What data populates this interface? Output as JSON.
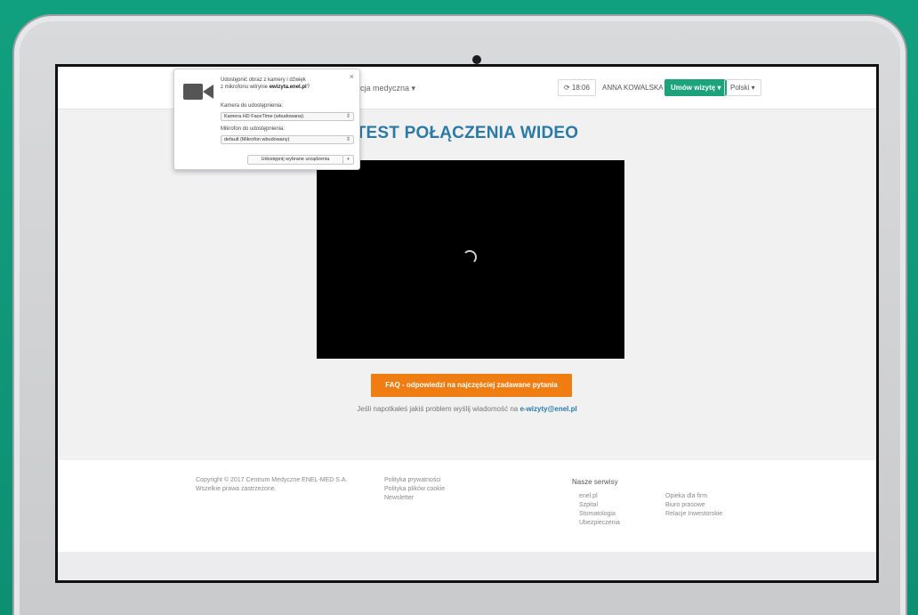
{
  "nav": {
    "menu_label": "cja medyczna ▾",
    "time_label": "⟳ 18:06",
    "user_label": "ANNA KOWALSKA ▾",
    "visit_label": "Umów wizytę ▾",
    "lang_label": "Polski ▾"
  },
  "permission_popup": {
    "message_line1": "Udostępnić obraz z kamery i dźwięk",
    "message_line2_prefix": "z mikrofonu witrynie",
    "message_site": "ewizyta.enel.pl",
    "message_suffix": "?",
    "close_label": "×",
    "camera_label": "Kamera do udostępnienia:",
    "camera_value": "Kamera HD FaceTime (wbudowana)",
    "mic_label": "Mikrofon do udostępnienia:",
    "mic_value": "default (Mikrofon wbudowany)",
    "share_button": "Udostępnij wybrane urządzenia",
    "share_dropdown": "▾"
  },
  "main": {
    "title": "TEST POŁĄCZENIA WIDEO",
    "faq_button": "FAQ - odpowiedzi na najczęściej zadawane pytania",
    "help_text": "Jeśli napotkałeś jakiś problem wyślij wiadomość na",
    "help_email": "e-wizyty@enel.pl"
  },
  "footer": {
    "copyright_line1": "Copyright © 2017 Centrum Medyczne ENEL-MED S.A.",
    "copyright_line2": "Wszelkie prawa zastrzeżone.",
    "links": [
      "Polityka prywatności",
      "Polityka plików cookie",
      "Newsletter"
    ],
    "services_title": "Nasze serwisy",
    "services_col1": [
      "enel.pl",
      "Szpital",
      "Stomatologia",
      "Ubezpieczenia"
    ],
    "services_col2": [
      "Opieka dla firm",
      "Biuro prasowe",
      "Relacje Inwestorskie"
    ]
  },
  "colors": {
    "background": "#0f9a7a",
    "accent_blue": "#2b7aa6",
    "faq_orange": "#ef7d12",
    "visit_green": "#1da37b"
  }
}
